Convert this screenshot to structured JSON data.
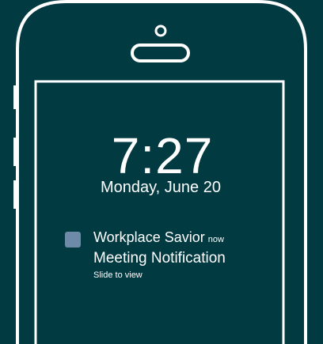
{
  "lockscreen": {
    "time": "7:27",
    "date": "Monday, June 20"
  },
  "notification": {
    "app_name": "Workplace Savior",
    "time_label": "now",
    "title": "Meeting Notification",
    "hint": "Slide to view",
    "icon": "app-icon"
  },
  "colors": {
    "background": "#023a41",
    "outline": "#ffffff",
    "app_icon": "#6e8aa9"
  }
}
